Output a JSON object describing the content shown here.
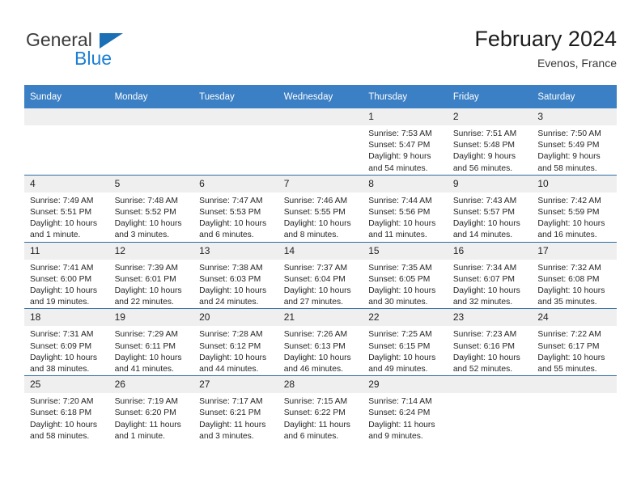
{
  "brand": {
    "name_part1": "General",
    "name_part2": "Blue",
    "triangle_color": "#1b6fb5",
    "blue_color": "#1b7fd4"
  },
  "header": {
    "title": "February 2024",
    "location": "Evenos, France"
  },
  "theme": {
    "header_bg": "#3b7fc4",
    "row_border": "#2e6da4",
    "daynum_bg": "#efefef"
  },
  "weekdays": [
    "Sunday",
    "Monday",
    "Tuesday",
    "Wednesday",
    "Thursday",
    "Friday",
    "Saturday"
  ],
  "labels": {
    "sunrise_prefix": "Sunrise:",
    "sunset_prefix": "Sunset:",
    "daylight_prefix": "Daylight:"
  },
  "weeks": [
    [
      {
        "day": "",
        "empty": true
      },
      {
        "day": "",
        "empty": true
      },
      {
        "day": "",
        "empty": true
      },
      {
        "day": "",
        "empty": true
      },
      {
        "day": "1",
        "sunrise": "Sunrise: 7:53 AM",
        "sunset": "Sunset: 5:47 PM",
        "daylight": "Daylight: 9 hours and 54 minutes."
      },
      {
        "day": "2",
        "sunrise": "Sunrise: 7:51 AM",
        "sunset": "Sunset: 5:48 PM",
        "daylight": "Daylight: 9 hours and 56 minutes."
      },
      {
        "day": "3",
        "sunrise": "Sunrise: 7:50 AM",
        "sunset": "Sunset: 5:49 PM",
        "daylight": "Daylight: 9 hours and 58 minutes."
      }
    ],
    [
      {
        "day": "4",
        "sunrise": "Sunrise: 7:49 AM",
        "sunset": "Sunset: 5:51 PM",
        "daylight": "Daylight: 10 hours and 1 minute."
      },
      {
        "day": "5",
        "sunrise": "Sunrise: 7:48 AM",
        "sunset": "Sunset: 5:52 PM",
        "daylight": "Daylight: 10 hours and 3 minutes."
      },
      {
        "day": "6",
        "sunrise": "Sunrise: 7:47 AM",
        "sunset": "Sunset: 5:53 PM",
        "daylight": "Daylight: 10 hours and 6 minutes."
      },
      {
        "day": "7",
        "sunrise": "Sunrise: 7:46 AM",
        "sunset": "Sunset: 5:55 PM",
        "daylight": "Daylight: 10 hours and 8 minutes."
      },
      {
        "day": "8",
        "sunrise": "Sunrise: 7:44 AM",
        "sunset": "Sunset: 5:56 PM",
        "daylight": "Daylight: 10 hours and 11 minutes."
      },
      {
        "day": "9",
        "sunrise": "Sunrise: 7:43 AM",
        "sunset": "Sunset: 5:57 PM",
        "daylight": "Daylight: 10 hours and 14 minutes."
      },
      {
        "day": "10",
        "sunrise": "Sunrise: 7:42 AM",
        "sunset": "Sunset: 5:59 PM",
        "daylight": "Daylight: 10 hours and 16 minutes."
      }
    ],
    [
      {
        "day": "11",
        "sunrise": "Sunrise: 7:41 AM",
        "sunset": "Sunset: 6:00 PM",
        "daylight": "Daylight: 10 hours and 19 minutes."
      },
      {
        "day": "12",
        "sunrise": "Sunrise: 7:39 AM",
        "sunset": "Sunset: 6:01 PM",
        "daylight": "Daylight: 10 hours and 22 minutes."
      },
      {
        "day": "13",
        "sunrise": "Sunrise: 7:38 AM",
        "sunset": "Sunset: 6:03 PM",
        "daylight": "Daylight: 10 hours and 24 minutes."
      },
      {
        "day": "14",
        "sunrise": "Sunrise: 7:37 AM",
        "sunset": "Sunset: 6:04 PM",
        "daylight": "Daylight: 10 hours and 27 minutes."
      },
      {
        "day": "15",
        "sunrise": "Sunrise: 7:35 AM",
        "sunset": "Sunset: 6:05 PM",
        "daylight": "Daylight: 10 hours and 30 minutes."
      },
      {
        "day": "16",
        "sunrise": "Sunrise: 7:34 AM",
        "sunset": "Sunset: 6:07 PM",
        "daylight": "Daylight: 10 hours and 32 minutes."
      },
      {
        "day": "17",
        "sunrise": "Sunrise: 7:32 AM",
        "sunset": "Sunset: 6:08 PM",
        "daylight": "Daylight: 10 hours and 35 minutes."
      }
    ],
    [
      {
        "day": "18",
        "sunrise": "Sunrise: 7:31 AM",
        "sunset": "Sunset: 6:09 PM",
        "daylight": "Daylight: 10 hours and 38 minutes."
      },
      {
        "day": "19",
        "sunrise": "Sunrise: 7:29 AM",
        "sunset": "Sunset: 6:11 PM",
        "daylight": "Daylight: 10 hours and 41 minutes."
      },
      {
        "day": "20",
        "sunrise": "Sunrise: 7:28 AM",
        "sunset": "Sunset: 6:12 PM",
        "daylight": "Daylight: 10 hours and 44 minutes."
      },
      {
        "day": "21",
        "sunrise": "Sunrise: 7:26 AM",
        "sunset": "Sunset: 6:13 PM",
        "daylight": "Daylight: 10 hours and 46 minutes."
      },
      {
        "day": "22",
        "sunrise": "Sunrise: 7:25 AM",
        "sunset": "Sunset: 6:15 PM",
        "daylight": "Daylight: 10 hours and 49 minutes."
      },
      {
        "day": "23",
        "sunrise": "Sunrise: 7:23 AM",
        "sunset": "Sunset: 6:16 PM",
        "daylight": "Daylight: 10 hours and 52 minutes."
      },
      {
        "day": "24",
        "sunrise": "Sunrise: 7:22 AM",
        "sunset": "Sunset: 6:17 PM",
        "daylight": "Daylight: 10 hours and 55 minutes."
      }
    ],
    [
      {
        "day": "25",
        "sunrise": "Sunrise: 7:20 AM",
        "sunset": "Sunset: 6:18 PM",
        "daylight": "Daylight: 10 hours and 58 minutes."
      },
      {
        "day": "26",
        "sunrise": "Sunrise: 7:19 AM",
        "sunset": "Sunset: 6:20 PM",
        "daylight": "Daylight: 11 hours and 1 minute."
      },
      {
        "day": "27",
        "sunrise": "Sunrise: 7:17 AM",
        "sunset": "Sunset: 6:21 PM",
        "daylight": "Daylight: 11 hours and 3 minutes."
      },
      {
        "day": "28",
        "sunrise": "Sunrise: 7:15 AM",
        "sunset": "Sunset: 6:22 PM",
        "daylight": "Daylight: 11 hours and 6 minutes."
      },
      {
        "day": "29",
        "sunrise": "Sunrise: 7:14 AM",
        "sunset": "Sunset: 6:24 PM",
        "daylight": "Daylight: 11 hours and 9 minutes."
      },
      {
        "day": "",
        "empty": true
      },
      {
        "day": "",
        "empty": true
      }
    ]
  ]
}
